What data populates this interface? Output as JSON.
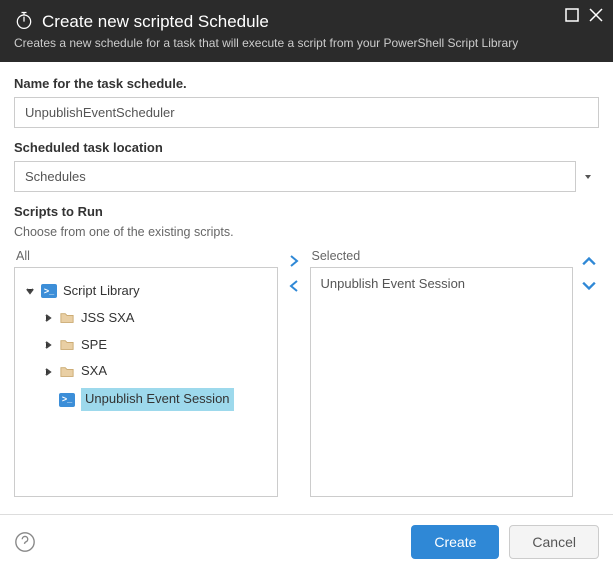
{
  "header": {
    "title": "Create new scripted Schedule",
    "subtitle": "Creates a new schedule for a task that will execute a script from your PowerShell Script Library"
  },
  "fields": {
    "name_label": "Name for the task schedule.",
    "name_value": "UnpublishEventScheduler",
    "location_label": "Scheduled task location",
    "location_value": "Schedules",
    "scripts_label": "Scripts to Run",
    "scripts_sub": "Choose from one of the existing scripts.",
    "all_header": "All",
    "selected_header": "Selected"
  },
  "tree": {
    "root": "Script Library",
    "children": [
      "JSS SXA",
      "SPE",
      "SXA",
      "Unpublish Event Session"
    ],
    "selected_index": 3
  },
  "selected": {
    "items": [
      "Unpublish Event Session"
    ]
  },
  "footer": {
    "create_label": "Create",
    "cancel_label": "Cancel"
  }
}
